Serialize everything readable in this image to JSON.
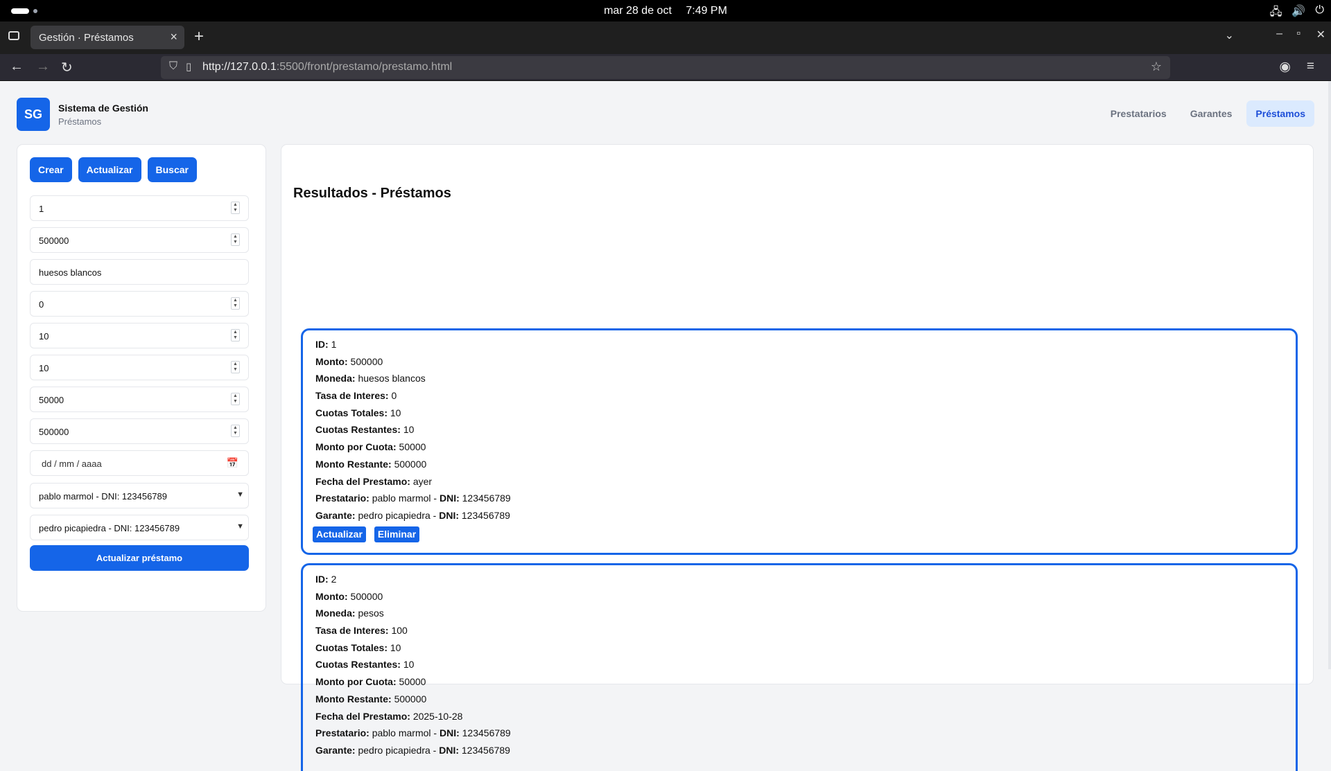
{
  "os": {
    "date": "mar 28 de oct",
    "time": "7:49 PM",
    "tray_icons": [
      "network-icon",
      "volume-icon",
      "power-icon"
    ]
  },
  "browser": {
    "tab_title": "Gestión · Préstamos",
    "url_host": "http://127.0.0.1",
    "url_rest": ":5500/front/prestamo/prestamo.html"
  },
  "header": {
    "logo": "SG",
    "title": "Sistema de Gestión",
    "subtitle": "Préstamos",
    "nav": [
      {
        "label": "Prestatarios",
        "active": false
      },
      {
        "label": "Garantes",
        "active": false
      },
      {
        "label": "Préstamos",
        "active": true
      }
    ]
  },
  "form": {
    "actions": {
      "crear": "Crear",
      "actualizar": "Actualizar",
      "buscar": "Buscar"
    },
    "fields": {
      "id": "1",
      "monto": "500000",
      "moneda": "huesos blancos",
      "tasa": "0",
      "cuotas_totales": "10",
      "cuotas_restantes": "10",
      "monto_cuota": "50000",
      "monto_restante": "500000",
      "fecha_placeholder": "dd / mm / aaaa",
      "prestatario": "pablo marmol - DNI: 123456789",
      "garante": "pedro picapiedra - DNI: 123456789"
    },
    "submit_label": "Actualizar préstamo"
  },
  "results": {
    "title": "Resultados - Préstamos",
    "labels": {
      "id": "ID:",
      "monto": "Monto:",
      "moneda": "Moneda:",
      "tasa": "Tasa de Interes:",
      "cuotas_totales": "Cuotas Totales:",
      "cuotas_restantes": "Cuotas Restantes:",
      "monto_cuota": "Monto por Cuota:",
      "monto_restante": "Monto Restante:",
      "fecha": "Fecha del Prestamo:",
      "prestatario": "Prestatario:",
      "garante": "Garante:",
      "dni": "DNI:"
    },
    "loans": [
      {
        "id": "1",
        "monto": "500000",
        "moneda": "huesos blancos",
        "tasa": "0",
        "cuotas_totales": "10",
        "cuotas_restantes": "10",
        "monto_cuota": "50000",
        "monto_restante": "500000",
        "fecha": "ayer",
        "prestatario_nombre": "pablo marmol -",
        "prestatario_dni": "123456789",
        "garante_nombre": "pedro picapiedra -",
        "garante_dni": "123456789",
        "actualizar": "Actualizar",
        "eliminar": "Eliminar"
      },
      {
        "id": "2",
        "monto": "500000",
        "moneda": "pesos",
        "tasa": "100",
        "cuotas_totales": "10",
        "cuotas_restantes": "10",
        "monto_cuota": "50000",
        "monto_restante": "500000",
        "fecha": "2025-10-28",
        "prestatario_nombre": "pablo marmol -",
        "prestatario_dni": "123456789",
        "garante_nombre": "pedro picapiedra -",
        "garante_dni": "123456789"
      }
    ]
  }
}
